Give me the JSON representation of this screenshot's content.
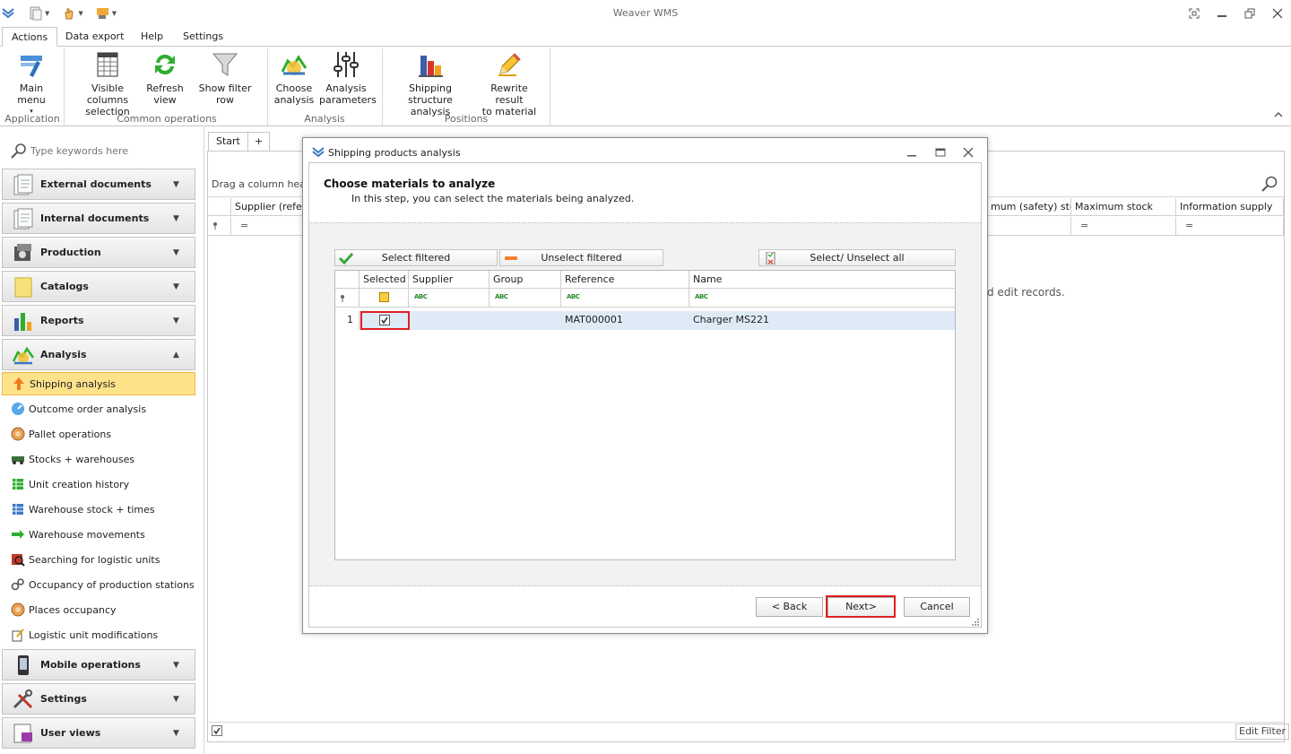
{
  "app": {
    "title": "Weaver WMS",
    "colors": {
      "accent": "#3b78c4",
      "nav_active_bg": "#fde28a",
      "nav_active_border": "#f0b94b",
      "highlight": "#e02020",
      "row_selected": "#dfeaf7"
    }
  },
  "ribbon": {
    "tabs": [
      "Actions",
      "Data export",
      "Help",
      "Settings"
    ],
    "buttons": [
      {
        "icon": "main-menu-icon",
        "label1": "Main menu",
        "label2": "▾"
      },
      {
        "icon": "columns-icon",
        "label1": "Visible columns",
        "label2": "selection"
      },
      {
        "icon": "refresh-icon",
        "label1": "Refresh",
        "label2": "view"
      },
      {
        "icon": "filter-icon",
        "label1": "Show filter row",
        "label2": ""
      },
      {
        "icon": "analysis-icon",
        "label1": "Choose",
        "label2": "analysis"
      },
      {
        "icon": "sliders-icon",
        "label1": "Analysis",
        "label2": "parameters"
      },
      {
        "icon": "bar-chart-icon",
        "label1": "Shipping structure",
        "label2": "analysis"
      },
      {
        "icon": "pencil-icon",
        "label1": "Rewrite result",
        "label2": "to material"
      }
    ],
    "groups": [
      "Application",
      "Common operations",
      "Analysis",
      "Positions"
    ]
  },
  "nav": {
    "search_placeholder": "Type keywords here",
    "groups_top": [
      {
        "label": "External documents",
        "icon": "document-icon"
      },
      {
        "label": "Internal documents",
        "icon": "document-icon"
      },
      {
        "label": "Production",
        "icon": "production-icon"
      },
      {
        "label": "Catalogs",
        "icon": "catalog-icon"
      },
      {
        "label": "Reports",
        "icon": "reports-icon"
      },
      {
        "label": "Analysis",
        "icon": "analysis-icon"
      }
    ],
    "items": [
      {
        "label": "Shipping analysis",
        "icon": "arrow-up-icon"
      },
      {
        "label": "Outcome order analysis",
        "icon": "gauge-icon"
      },
      {
        "label": "Pallet operations",
        "icon": "pallet-icon"
      },
      {
        "label": "Stocks + warehouses",
        "icon": "truck-icon"
      },
      {
        "label": "Unit creation history",
        "icon": "table-icon"
      },
      {
        "label": "Warehouse stock + times",
        "icon": "table-icon"
      },
      {
        "label": "Warehouse movements",
        "icon": "arrows-icon"
      },
      {
        "label": "Searching for logistic units",
        "icon": "search-units-icon"
      },
      {
        "label": "Occupancy of production stations",
        "icon": "gears-icon"
      },
      {
        "label": "Places occupancy",
        "icon": "pallet-icon"
      },
      {
        "label": "Logistic unit modifications",
        "icon": "edit-icon"
      }
    ],
    "groups_bottom": [
      {
        "label": "Mobile operations",
        "icon": "mobile-icon"
      },
      {
        "label": "Settings",
        "icon": "tools-icon"
      },
      {
        "label": "User views",
        "icon": "user-views-icon"
      }
    ]
  },
  "document": {
    "tabs": [
      "Start",
      "+"
    ],
    "group_panel_text": "Drag a column heade",
    "columns_left": [
      "Supplier (refere"
    ],
    "columns_right": [
      "mum (safety) sto...",
      "Maximum stock",
      "Information supply"
    ],
    "filter_symbol": "=",
    "grid_hint": "d  edit records.",
    "edit_filter": "Edit Filter"
  },
  "dialog": {
    "title": "Shipping products analysis",
    "heading": "Choose materials to analyze",
    "subheading": "In this step, you can select the materials being analyzed.",
    "buttons": {
      "select_filtered": "Select filtered",
      "unselect_filtered": "Unselect filtered",
      "select_all": "Select/ Unselect all",
      "back": "< Back",
      "next": "Next>",
      "cancel": "Cancel"
    },
    "grid": {
      "columns": [
        "Selected",
        "Supplier",
        "Group",
        "Reference",
        "Name"
      ],
      "filter_tag": "ABC",
      "rows": [
        {
          "num": "1",
          "selected": true,
          "supplier": "",
          "group": "",
          "reference": "MAT000001",
          "name": "Charger MS221"
        }
      ]
    }
  }
}
